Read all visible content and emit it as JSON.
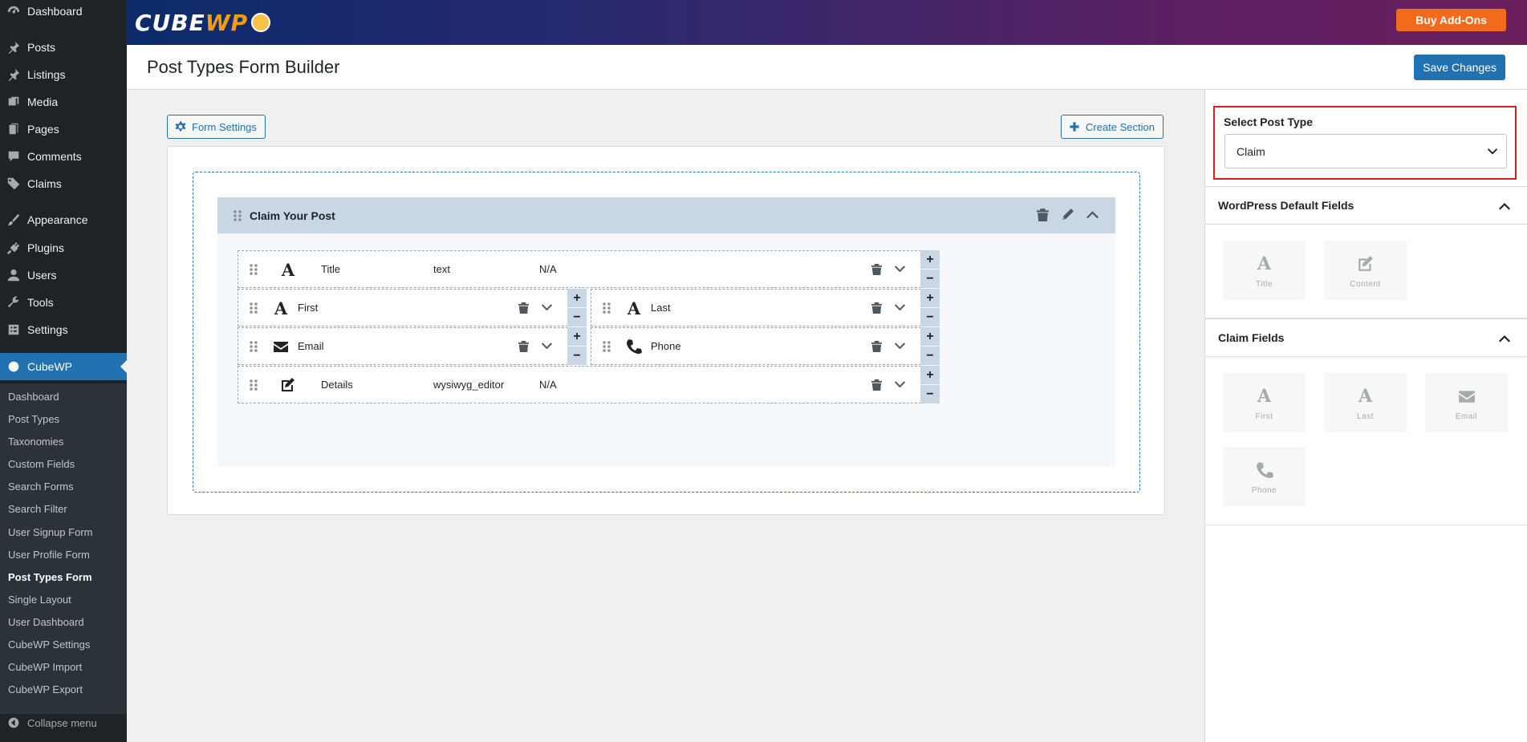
{
  "sidebar": {
    "menu": [
      {
        "label": "Dashboard",
        "icon": "dashboard-icon"
      },
      {
        "label": "Posts",
        "icon": "pin-icon"
      },
      {
        "label": "Listings",
        "icon": "pin-icon"
      },
      {
        "label": "Media",
        "icon": "media-icon"
      },
      {
        "label": "Pages",
        "icon": "pages-icon"
      },
      {
        "label": "Comments",
        "icon": "comment-icon"
      },
      {
        "label": "Claims",
        "icon": "tag-icon"
      },
      {
        "label": "Appearance",
        "icon": "brush-icon"
      },
      {
        "label": "Plugins",
        "icon": "plugin-icon"
      },
      {
        "label": "Users",
        "icon": "user-icon"
      },
      {
        "label": "Tools",
        "icon": "wrench-icon"
      },
      {
        "label": "Settings",
        "icon": "settings-icon"
      },
      {
        "label": "CubeWP",
        "icon": "cubewp-icon"
      }
    ],
    "submenu": [
      "Dashboard",
      "Post Types",
      "Taxonomies",
      "Custom Fields",
      "Search Forms",
      "Search Filter",
      "User Signup Form",
      "User Profile Form",
      "Post Types Form",
      "Single Layout",
      "User Dashboard",
      "CubeWP Settings",
      "CubeWP Import",
      "CubeWP Export"
    ],
    "current_submenu": "Post Types Form",
    "collapse_label": "Collapse menu"
  },
  "banner": {
    "logo_text_a": "CUBE",
    "logo_text_b": "WP",
    "buy_addons_label": "Buy Add-Ons",
    "buy_addons_color": "#f26b1d"
  },
  "header": {
    "title": "Post Types Form Builder",
    "save_label": "Save Changes"
  },
  "builder": {
    "form_settings_label": "Form Settings",
    "create_section_label": "Create Section",
    "section": {
      "title": "Claim Your Post",
      "fields": [
        {
          "label": "Title",
          "type": "text",
          "na": "N/A",
          "icon": "text-a-icon"
        },
        {
          "label": "First",
          "icon": "text-a-icon"
        },
        {
          "label": "Last",
          "icon": "text-a-icon"
        },
        {
          "label": "Email",
          "icon": "envelope-icon"
        },
        {
          "label": "Phone",
          "icon": "phone-icon"
        },
        {
          "label": "Details",
          "type": "wysiwyg_editor",
          "na": "N/A",
          "icon": "edit-icon"
        }
      ]
    }
  },
  "right_panel": {
    "select_label": "Select Post Type",
    "select_value": "Claim",
    "wp_default_heading": "WordPress Default Fields",
    "wp_default_fields": [
      {
        "label": "Title",
        "icon": "text-a-icon"
      },
      {
        "label": "Content",
        "icon": "edit-icon"
      }
    ],
    "claim_heading": "Claim Fields",
    "claim_fields": [
      {
        "label": "First",
        "icon": "text-a-icon"
      },
      {
        "label": "Last",
        "icon": "text-a-icon"
      },
      {
        "label": "Email",
        "icon": "envelope-icon"
      },
      {
        "label": "Phone",
        "icon": "phone-icon"
      }
    ]
  }
}
